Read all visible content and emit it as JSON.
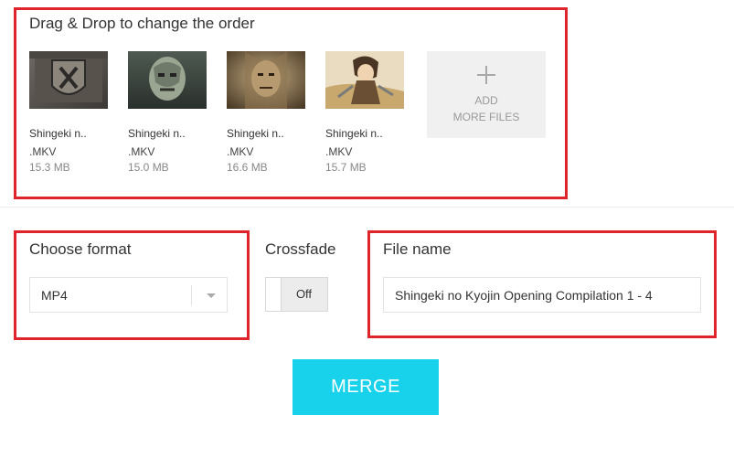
{
  "files_section": {
    "heading": "Drag & Drop to change the order",
    "files": [
      {
        "name": "Shingeki n..",
        "ext": ".MKV",
        "size": "15.3 MB",
        "thumb": "aot-emblem-thumbnail"
      },
      {
        "name": "Shingeki n..",
        "ext": ".MKV",
        "size": "15.0 MB",
        "thumb": "aot-titan-face-thumbnail"
      },
      {
        "name": "Shingeki n..",
        "ext": ".MKV",
        "size": "16.6 MB",
        "thumb": "aot-titan-closeup-thumbnail"
      },
      {
        "name": "Shingeki n..",
        "ext": ".MKV",
        "size": "15.7 MB",
        "thumb": "aot-character-thumbnail"
      }
    ],
    "add_more": {
      "line1": "ADD",
      "line2": "MORE FILES",
      "icon": "plus-icon"
    }
  },
  "format": {
    "label": "Choose format",
    "selected": "MP4"
  },
  "crossfade": {
    "label": "Crossfade",
    "state": "Off"
  },
  "file_name": {
    "label": "File name",
    "value": "Shingeki no Kyojin Opening Compilation 1 - 4"
  },
  "merge_button": "MERGE",
  "colors": {
    "annotation_red": "#e0242c",
    "merge_button_bg": "#18d1ea"
  }
}
